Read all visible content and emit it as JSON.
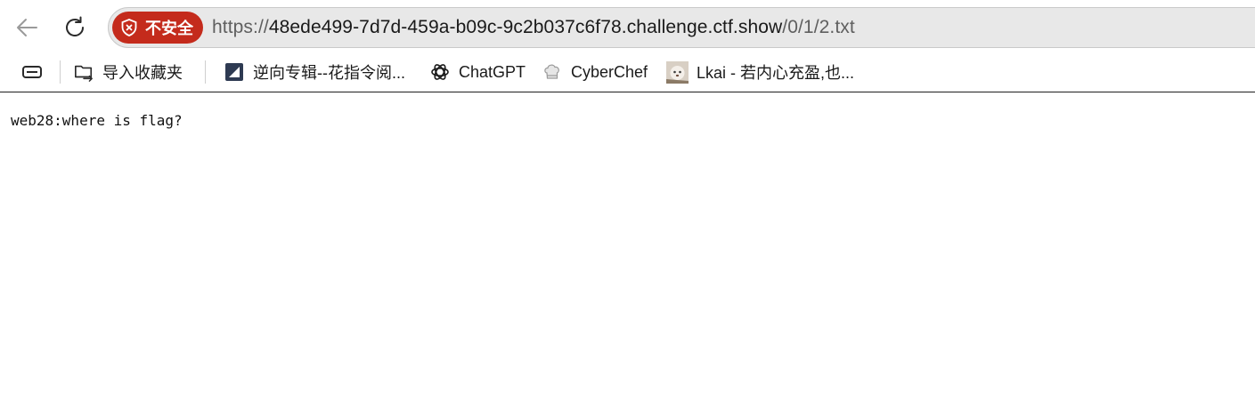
{
  "toolbar": {
    "back_icon": "back-arrow-icon",
    "reload_icon": "reload-icon"
  },
  "address_bar": {
    "security_label": "不安全",
    "security_icon": "shield-warning-icon",
    "security_color": "#c42b1c",
    "url_scheme": "https://",
    "url_host": "48ede499-7d7d-459a-b09c-9c2b037c6f78.challenge.ctf.show",
    "url_path": "/0/1/2.txt"
  },
  "bookmarks": {
    "sidebar_icon": "sidebar-toggle-icon",
    "items": [
      {
        "label": "导入收藏夹",
        "icon": "import-favorites-icon"
      },
      {
        "label": "逆向专辑--花指令阅...",
        "icon": "zhihu-column-icon"
      },
      {
        "label": "ChatGPT",
        "icon": "openai-icon"
      },
      {
        "label": "CyberChef",
        "icon": "chef-hat-icon"
      },
      {
        "label": "Lkai - 若内心充盈,也...",
        "icon": "avatar-icon"
      }
    ]
  },
  "page": {
    "text": "web28:where is flag?"
  }
}
